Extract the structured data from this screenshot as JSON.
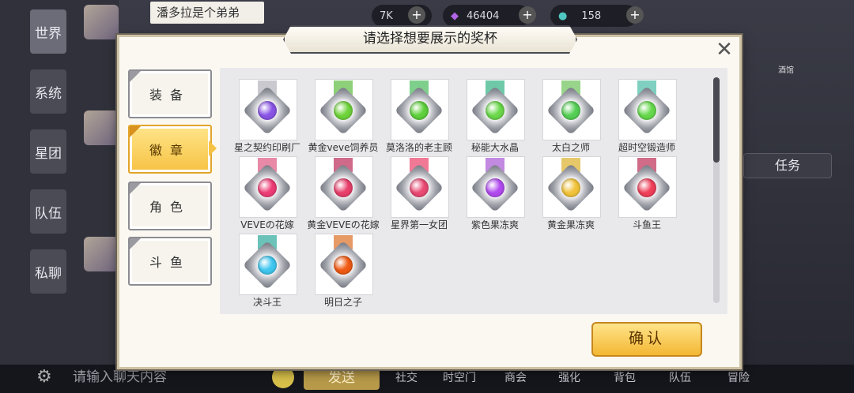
{
  "background": {
    "side_tabs": [
      "世界",
      "系统",
      "星团",
      "队伍",
      "私聊"
    ],
    "tip": "潘多拉是个弟弟",
    "resources": [
      {
        "icon": "coin-icon",
        "value": "7K"
      },
      {
        "icon": "diamond-icon",
        "value": "46404"
      },
      {
        "icon": "energy-icon",
        "value": "158"
      }
    ],
    "chat_placeholder": "请输入聊天内容",
    "send_label": "发送",
    "bottom_nav": [
      "社交",
      "时空门",
      "商会",
      "强化",
      "背包",
      "队伍",
      "冒险"
    ],
    "task_label": "任务",
    "badge_label": "酒馆"
  },
  "dialog": {
    "title": "请选择想要展示的奖杯",
    "categories": [
      {
        "label": "装备",
        "selected": false
      },
      {
        "label": "徽章",
        "selected": true
      },
      {
        "label": "角色",
        "selected": false
      },
      {
        "label": "斗鱼",
        "selected": false
      }
    ],
    "trophies": [
      {
        "name": "星之契约印刷厂",
        "gem": "#8a55e6",
        "ribbon": "#c9c9cf"
      },
      {
        "name": "黄金veve饲养员",
        "gem": "#6fd43a",
        "ribbon": "#8ed07a"
      },
      {
        "name": "莫洛洛的老主顾",
        "gem": "#5fd03c",
        "ribbon": "#7fcf8c"
      },
      {
        "name": "秘能大水晶",
        "gem": "#6bd94a",
        "ribbon": "#6fc9a8"
      },
      {
        "name": "太白之师",
        "gem": "#55cf55",
        "ribbon": "#98d48a"
      },
      {
        "name": "超时空锻造师",
        "gem": "#66d94c",
        "ribbon": "#7fd0c0"
      },
      {
        "name": "VEVEの花嫁",
        "gem": "#ee3d76",
        "ribbon": "#e889a8"
      },
      {
        "name": "黄金VEVEの花嫁",
        "gem": "#e83f6c",
        "ribbon": "#d06a8a"
      },
      {
        "name": "星界第一女团",
        "gem": "#ea4a74",
        "ribbon": "#f07a96"
      },
      {
        "name": "紫色果冻爽",
        "gem": "#b24bf0",
        "ribbon": "#c28ae0"
      },
      {
        "name": "黄金果冻爽",
        "gem": "#f2c33a",
        "ribbon": "#e6c86a"
      },
      {
        "name": "斗鱼王",
        "gem": "#f0405a",
        "ribbon": "#d06b88"
      },
      {
        "name": "决斗王",
        "gem": "#3fc7f0",
        "ribbon": "#6ac2b8"
      },
      {
        "name": "明日之子",
        "gem": "#f05a14",
        "ribbon": "#e69a66"
      }
    ],
    "confirm_label": "确认"
  }
}
